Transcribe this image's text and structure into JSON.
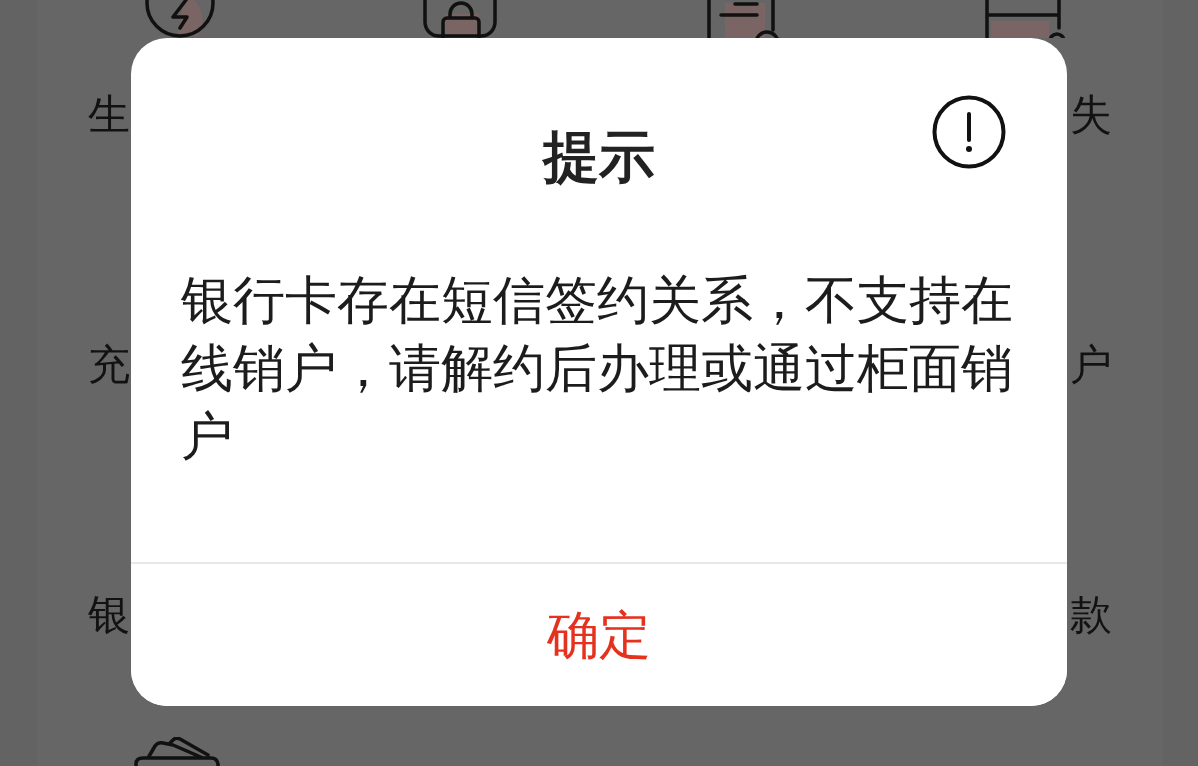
{
  "background_page": {
    "label_rows": [
      {
        "left": "生",
        "right": "失"
      },
      {
        "left": "充",
        "right": "户"
      },
      {
        "left": "银",
        "right": "款"
      }
    ]
  },
  "dialog": {
    "title": "提示",
    "message": "银行卡存在短信签约关系，不支持在线销户，请解约后办理或通过柜面销户",
    "confirm_button": "确定"
  }
}
